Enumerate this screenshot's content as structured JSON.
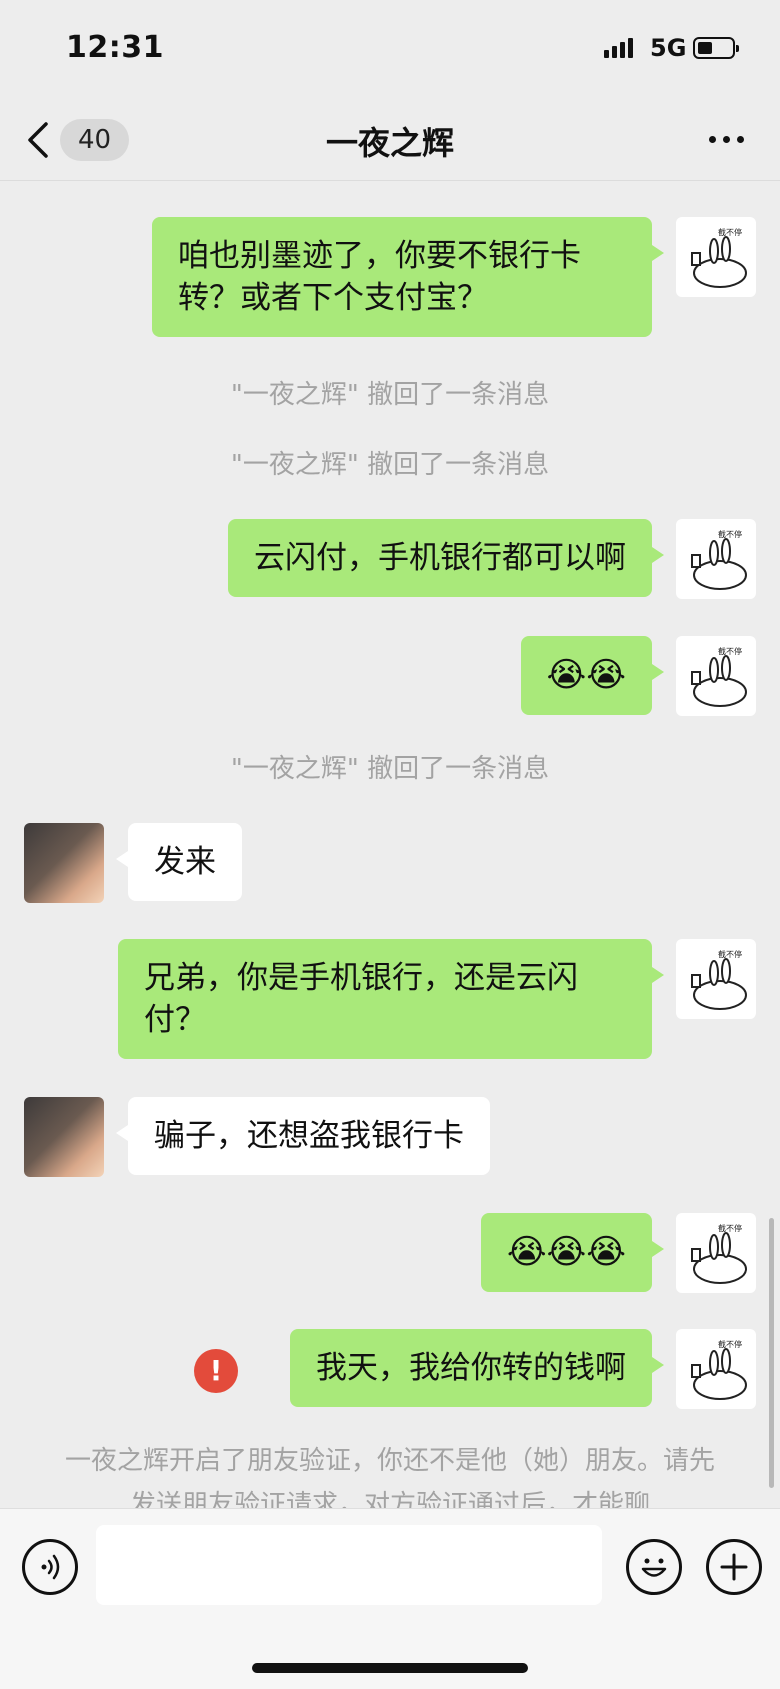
{
  "status": {
    "time": "12:31",
    "network": "5G"
  },
  "nav": {
    "unread": "40",
    "title": "一夜之辉"
  },
  "messages": {
    "m1": "咱也别墨迹了，你要不银行卡转？或者下个支付宝？",
    "sys1": "\"一夜之辉\" 撤回了一条消息",
    "sys2": "\"一夜之辉\" 撤回了一条消息",
    "m2": "云闪付，手机银行都可以啊",
    "m3": "😭😭",
    "sys3": "\"一夜之辉\" 撤回了一条消息",
    "m4": "发来",
    "m5": "兄弟，你是手机银行，还是云闪付？",
    "m6": "骗子，还想盗我银行卡",
    "m7": "😭😭😭",
    "m8": "我天，我给你转的钱啊",
    "notice": "一夜之辉开启了朋友验证，你还不是他（她）朋友。请先发送朋友验证请求，对方验证通过后，才能聊"
  },
  "error_mark": "!",
  "colors": {
    "my_bubble": "#a9e97a",
    "their_bubble": "#ffffff",
    "background": "#ededed",
    "error": "#e34b3b"
  },
  "icons": [
    "back-chevron-icon",
    "more-icon",
    "voice-icon",
    "emoji-icon",
    "plus-icon",
    "error-icon"
  ]
}
